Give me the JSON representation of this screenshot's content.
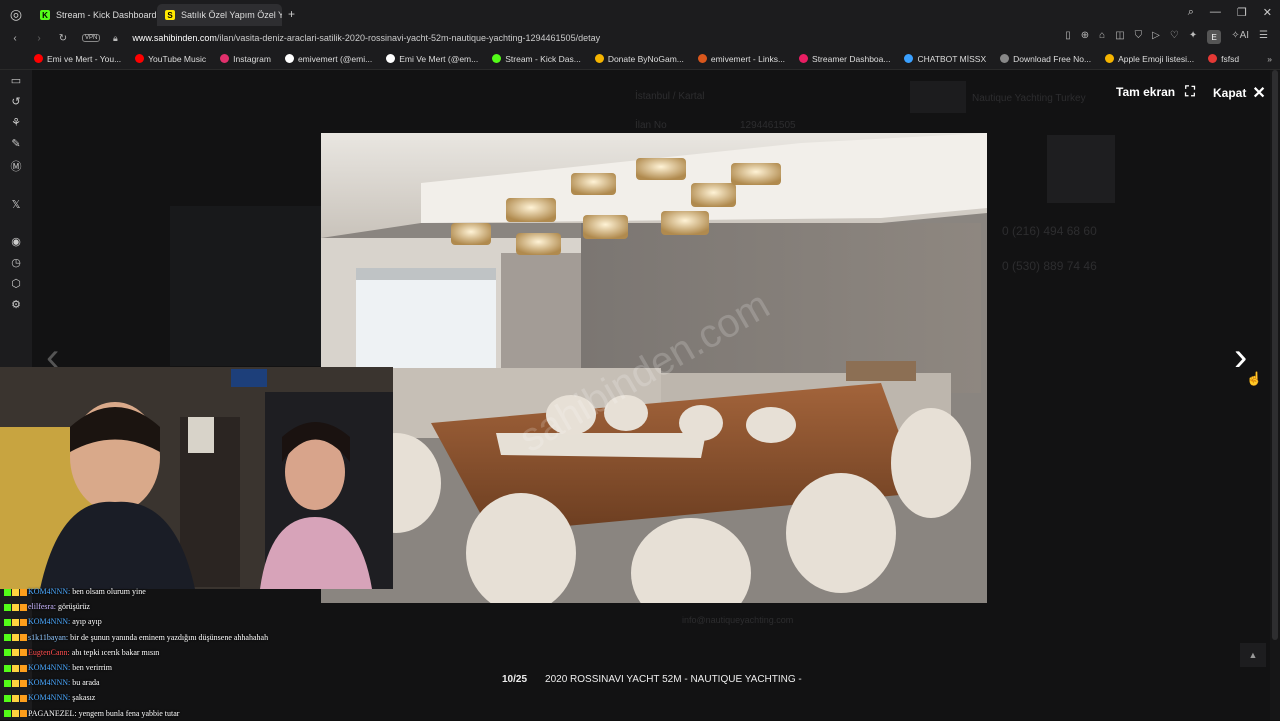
{
  "tabs": [
    {
      "label": "Stream - Kick Dashboard",
      "color": "#53fc18",
      "letter": "K",
      "active": false
    },
    {
      "label": "Satılık Özel Yapım Özel Ya",
      "color": "#ffe800",
      "letter": "S",
      "active": true
    }
  ],
  "address": {
    "domain": "www.sahibinden.com",
    "path": "/ilan/vasita-deniz-araclari-satilik-2020-rossinavi-yacht-52m-nautique-yachting-1294461505/detay",
    "vpn": "VPN"
  },
  "bookmarks": [
    {
      "label": "Emi ve Mert - You...",
      "color": "#ff0000"
    },
    {
      "label": "YouTube Music",
      "color": "#ff0000"
    },
    {
      "label": "Instagram",
      "color": "#e1306c"
    },
    {
      "label": "emivemert (@emi...",
      "color": "#ffffff"
    },
    {
      "label": "Emi Ve Mert (@em...",
      "color": "#ffffff"
    },
    {
      "label": "Stream - Kick Das...",
      "color": "#53fc18"
    },
    {
      "label": "Donate ByNoGam...",
      "color": "#f5b400"
    },
    {
      "label": "emivemert - Links...",
      "color": "#d9571c"
    },
    {
      "label": "Streamer Dashboa...",
      "color": "#e91e63"
    },
    {
      "label": "CHATBOT MİSSX",
      "color": "#3aa0ff"
    },
    {
      "label": "Download Free No...",
      "color": "#888888"
    },
    {
      "label": "Apple Emoji listesi...",
      "color": "#f5b400"
    },
    {
      "label": "fsfsd",
      "color": "#e53935"
    }
  ],
  "gallery": {
    "fullscreen_label": "Tam ekran",
    "close_label": "Kapat",
    "counter": "10/25",
    "title": "2020 ROSSINAVI YACHT 52M - NAUTIQUE YACHTING -",
    "watermark": "sahibinden.com"
  },
  "background_page": {
    "breadcrumb": "İstanbul / Kartal",
    "listing_label": "İlan No",
    "listing_no": "1294461505",
    "seller": "Nautique Yachting Turkey",
    "phone1": "0 (216) 494 68 60",
    "phone2": "0 (530) 889 74 46",
    "email": "info@nautiqueyachting.com"
  },
  "chat": [
    {
      "user": "KOM4NNN:",
      "msg": "ben olsam olurum yine",
      "color": "#4aa8ff"
    },
    {
      "user": "elilfesra:",
      "msg": "görüşürüz",
      "color": "#c9b6ff"
    },
    {
      "user": "KOM4NNN:",
      "msg": "ayıp ayıp",
      "color": "#4aa8ff"
    },
    {
      "user": "s1k11bayan:",
      "msg": "bir de şunun yanında eminem yazdığını düşünsene ahhahahah",
      "color": "#8fc7ff"
    },
    {
      "user": "EugtenCann:",
      "msg": "abı tepki ıcerık bakar mısın",
      "color": "#ff4d4d"
    },
    {
      "user": "KOM4NNN:",
      "msg": "ben verirrim",
      "color": "#4aa8ff"
    },
    {
      "user": "KOM4NNN:",
      "msg": "bu arada",
      "color": "#4aa8ff"
    },
    {
      "user": "KOM4NNN:",
      "msg": "şakasız",
      "color": "#4aa8ff"
    },
    {
      "user": "PAGANEZEL:",
      "msg": "yengem bunla fena yabbie tutar",
      "color": "#ffffff"
    }
  ]
}
